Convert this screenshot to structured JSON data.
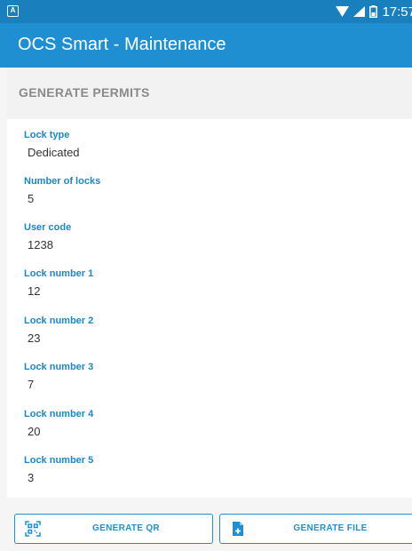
{
  "status_bar": {
    "app_icon_letter": "A",
    "time": "17:57",
    "icons": [
      "wifi-icon",
      "signal-icon",
      "battery-icon"
    ]
  },
  "app_bar": {
    "title": "OCS Smart - Maintenance"
  },
  "section": {
    "title": "GENERATE PERMITS"
  },
  "fields": [
    {
      "label": "Lock type",
      "value": "Dedicated"
    },
    {
      "label": "Number of locks",
      "value": "5"
    },
    {
      "label": "User code",
      "value": "1238"
    },
    {
      "label": "Lock number 1",
      "value": "12"
    },
    {
      "label": "Lock number 2",
      "value": "23"
    },
    {
      "label": "Lock number 3",
      "value": "7"
    },
    {
      "label": "Lock number 4",
      "value": "20"
    },
    {
      "label": "Lock number 5",
      "value": "3"
    }
  ],
  "buttons": {
    "generate_qr": {
      "label": "GENERATE QR",
      "icon": "qr-code-icon"
    },
    "generate_file": {
      "label": "GENERATE FILE",
      "icon": "add-file-icon"
    }
  },
  "colors": {
    "status_bar": "#1a80bd",
    "app_bar": "#1f8fd2",
    "accent": "#1a87c7",
    "section_title": "#8a8a8a"
  }
}
